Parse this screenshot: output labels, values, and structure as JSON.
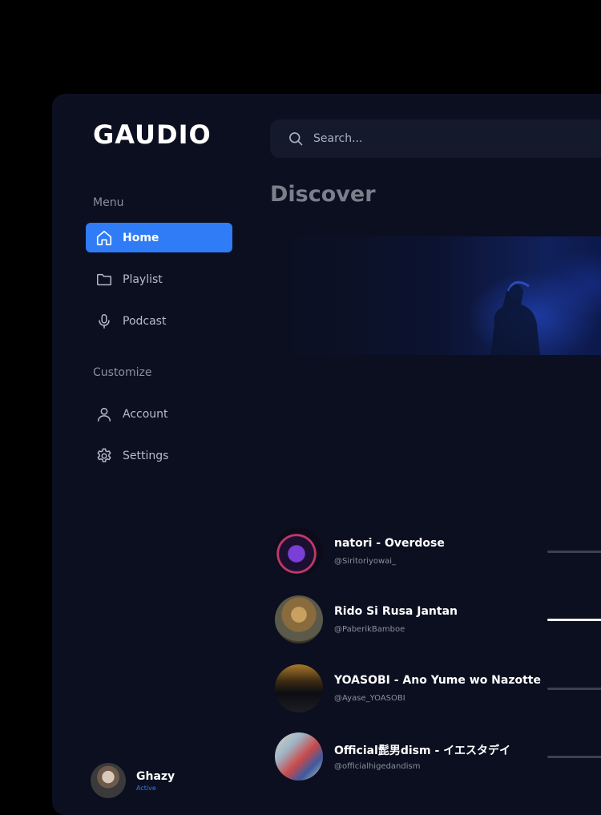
{
  "app": {
    "logo": "GAUDIO"
  },
  "sidebar": {
    "menu_label": "Menu",
    "menu_items": [
      {
        "label": "Home",
        "icon": "home-icon",
        "active": true
      },
      {
        "label": "Playlist",
        "icon": "folder-icon",
        "active": false
      },
      {
        "label": "Podcast",
        "icon": "microphone-icon",
        "active": false
      }
    ],
    "customize_label": "Customize",
    "customize_items": [
      {
        "label": "Account",
        "icon": "user-icon"
      },
      {
        "label": "Settings",
        "icon": "gear-icon"
      }
    ]
  },
  "user": {
    "name": "Ghazy",
    "status": "Active"
  },
  "search": {
    "placeholder": "Search..."
  },
  "main": {
    "title": "Discover"
  },
  "tracks": [
    {
      "title": "natori - Overdose",
      "handle": "@Siritoriyowai_",
      "progress": 0.0
    },
    {
      "title": "Rido Si Rusa Jantan",
      "handle": "@PaberikBamboe",
      "progress": 0.6
    },
    {
      "title": "YOASOBI - Ano Yume wo Nazotte",
      "handle": "@Ayase_YOASOBI",
      "progress": 0.0
    },
    {
      "title": "Official髭男dism - イエスタデイ",
      "handle": "@officialhigedandism",
      "progress": 0.0
    }
  ],
  "colors": {
    "accent": "#2f7cf6",
    "background": "#0b0f1f",
    "page": "#000000"
  }
}
